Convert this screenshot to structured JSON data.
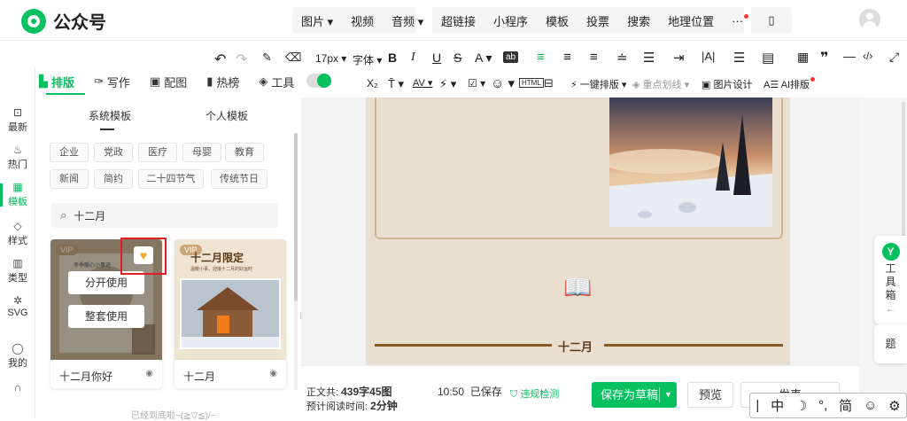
{
  "app": {
    "name": "公众号"
  },
  "topbar": {
    "group1": [
      "图片",
      "视频",
      "音频"
    ],
    "group2": [
      "超链接",
      "小程序",
      "模板",
      "投票",
      "搜索",
      "地理位置"
    ],
    "more_label": "···"
  },
  "toolbar": {
    "font_size": "17px",
    "font_family": "字体",
    "one_click_layout": "一键排版",
    "highlight_line": "重点划线",
    "image_design": "图片设计",
    "ai_layout": "AI排版"
  },
  "left_nav": [
    {
      "label": "最新",
      "icon": "clock-icon"
    },
    {
      "label": "热门",
      "icon": "fire-icon"
    },
    {
      "label": "模板",
      "icon": "template-icon",
      "active": true
    },
    {
      "label": "样式",
      "icon": "style-icon"
    },
    {
      "label": "类型",
      "icon": "type-icon"
    },
    {
      "label": "SVG",
      "icon": "svg-icon"
    },
    {
      "label": "我的",
      "icon": "user-icon"
    }
  ],
  "panel_tabs": [
    {
      "label": "排版",
      "icon": "layout-icon",
      "active": true
    },
    {
      "label": "写作",
      "icon": "pen-icon"
    },
    {
      "label": "配图",
      "icon": "image-icon"
    },
    {
      "label": "热榜",
      "icon": "bookmark-icon"
    },
    {
      "label": "工具",
      "icon": "cube-icon"
    }
  ],
  "template_tabs": [
    "系统模板",
    "个人模板"
  ],
  "categories": [
    "企业",
    "党政",
    "医疗",
    "母婴",
    "教育",
    "新闻",
    "简约",
    "二十四节气",
    "传统节日"
  ],
  "search": {
    "value": "十二月"
  },
  "cards": [
    {
      "title": "十二月你好",
      "badge": "VIP",
      "thumb_text": "冬季暖心小事迹",
      "btn_partial": "分开使用",
      "btn_full": "整套使用"
    },
    {
      "title": "十二月",
      "badge": "VIP",
      "thumb_title": "十二月限定",
      "thumb_sub": "温暖小事，迎接十二月的好运时"
    }
  ],
  "end_text": "已经到底啦~(≧▽≦)/~",
  "article": {
    "divider_title": "十二月"
  },
  "status": {
    "word_count_label": "正文共:",
    "word_count": "439字",
    "image_count": "45图",
    "read_time_label": "预计阅读时间:",
    "read_time": "2分钟",
    "saved_time": "10:50",
    "saved_label": "已保存",
    "violation_check": "违规检测"
  },
  "actions": {
    "save_draft": "保存为草稿",
    "preview": "预览",
    "publish": "发表"
  },
  "ime": [
    "中",
    "°,",
    "简"
  ],
  "toolbox": {
    "label_chars": [
      "工",
      "具",
      "箱"
    ],
    "title_char": "题"
  },
  "colors": {
    "accent": "#07c160",
    "highlight_box": "#e02020",
    "article_bg": "#e8dfd0",
    "divider": "#8a5a26"
  }
}
